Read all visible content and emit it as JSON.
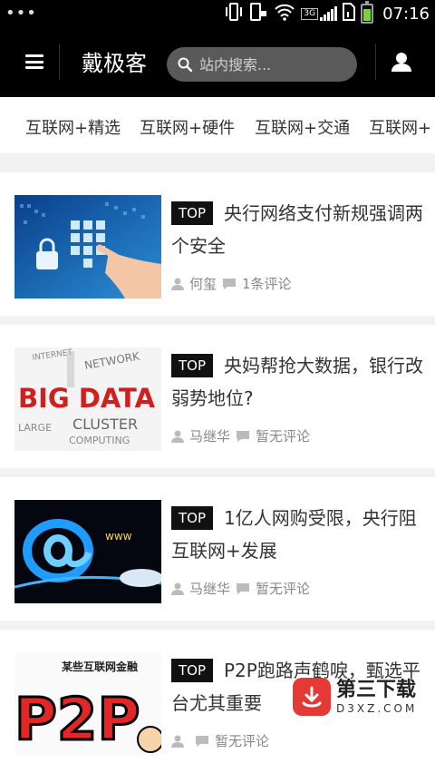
{
  "status_bar": {
    "dots": "•••",
    "time": "07:16",
    "network": "3G",
    "icons": [
      "vibrate-icon",
      "phone-icon",
      "wifi-icon",
      "signal-icon",
      "sim-icon",
      "battery-icon"
    ]
  },
  "header": {
    "brand": "戴极客",
    "search_placeholder": "站内搜索...",
    "menu_icon": "menu-icon",
    "user_icon": "user-icon"
  },
  "tabs": [
    {
      "label": "互联网+精选"
    },
    {
      "label": "互联网+硬件"
    },
    {
      "label": "互联网+交通"
    },
    {
      "label": "互联网+"
    }
  ],
  "articles": [
    {
      "badge": "TOP",
      "title": "央行网络支付新规强调两个安全",
      "author": "何玺",
      "comments": "1条评论",
      "thumb": "security-keypad"
    },
    {
      "badge": "TOP",
      "title": "央妈帮抢大数据，银行改弱势地位?",
      "author": "马继华",
      "comments": "暂无评论",
      "thumb": "big-data"
    },
    {
      "badge": "TOP",
      "title": "1亿人网购受限，央行阻互联网+发展",
      "author": "马继华",
      "comments": "暂无评论",
      "thumb": "at-sign"
    },
    {
      "badge": "TOP",
      "title": "P2P跑路声鹤唳，甄选平台尤其重要",
      "author": "",
      "comments": "暂无评论",
      "thumb": "p2p"
    }
  ],
  "thumb_text": {
    "big_data": "BIG DATA",
    "cluster": "CLUSTER",
    "network": "NETWORK",
    "internet": "INTERNET",
    "computing": "COMPUTING",
    "large": "LARGE",
    "p2p_banner": "某些互联网金融",
    "p2p": "P2P"
  },
  "watermark": {
    "cn": "第三下载",
    "en": "D3XZ.COM"
  },
  "colors": {
    "header_bg": "#000000",
    "badge_bg": "#111111",
    "page_bg": "#f2f2f2",
    "watermark_red": "#e53935"
  }
}
